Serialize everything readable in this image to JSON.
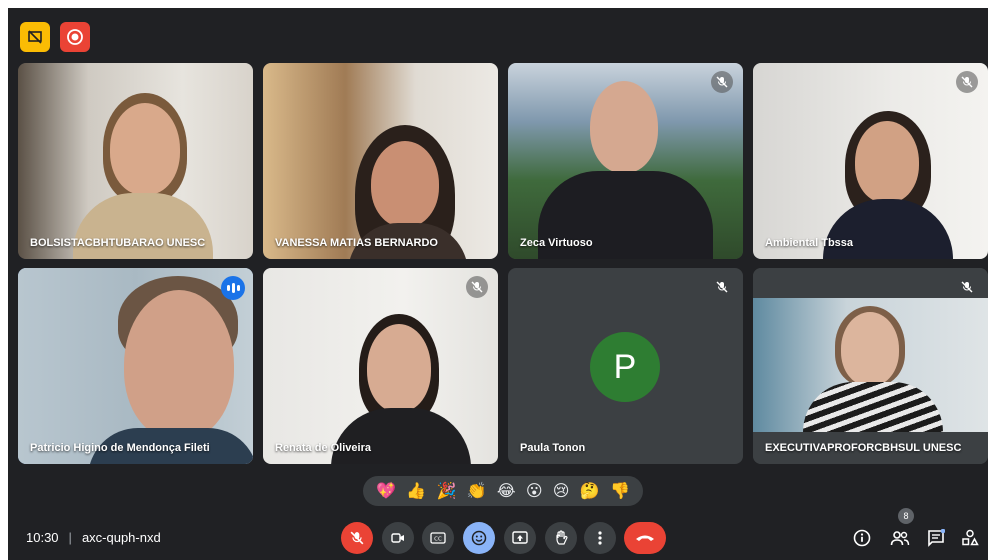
{
  "meeting": {
    "time": "10:30",
    "code": "axc-quph-nxd",
    "participant_count": "8"
  },
  "participants": [
    {
      "name": "BOLSISTACBHTUBARAO UNESC",
      "muted": false,
      "speaking": false
    },
    {
      "name": "VANESSA MATIAS BERNARDO",
      "muted": false,
      "speaking": false
    },
    {
      "name": "Zeca Virtuoso",
      "muted": true,
      "speaking": false
    },
    {
      "name": "Ambiental Tbssa",
      "muted": true,
      "speaking": false
    },
    {
      "name": "Patricio Higino de Mendonça Fileti",
      "muted": false,
      "speaking": true
    },
    {
      "name": "Renata de Oliveira",
      "muted": true,
      "speaking": false
    },
    {
      "name": "Paula Tonon",
      "muted": true,
      "speaking": false,
      "avatar_letter": "P",
      "avatar_color": "#2e7d32"
    },
    {
      "name": "EXECUTIVAPROFORCBHSUL UNESC",
      "muted": true,
      "speaking": false
    }
  ],
  "reactions": [
    "💖",
    "👍",
    "🎉",
    "👏",
    "😂",
    "😮",
    "😢",
    "🤔",
    "👎"
  ],
  "controls": [
    "mic-off-icon",
    "camera-icon",
    "captions-icon",
    "emoji-icon",
    "present-icon",
    "raise-hand-icon",
    "more-options-icon",
    "leave-call-icon"
  ],
  "right_controls": [
    "info-icon",
    "people-icon",
    "chat-icon",
    "activities-icon"
  ],
  "colors": {
    "background": "#202124",
    "tile": "#3c4043",
    "accent": "#8ab4f8",
    "danger": "#ea4335"
  }
}
